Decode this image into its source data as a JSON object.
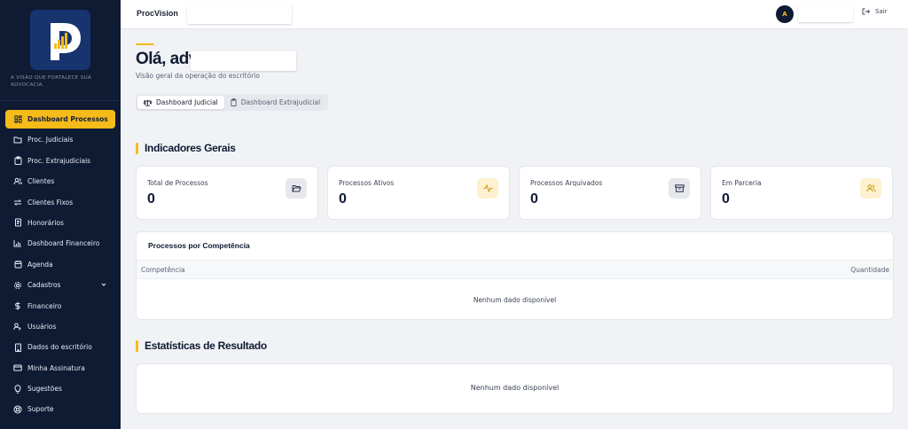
{
  "app": {
    "brand": "ProcVision",
    "tagline": "A visão que fortalece sua advocacia."
  },
  "sidebar": {
    "items": [
      {
        "label": "Dashboard Processos",
        "icon": "dashboard-grid-icon",
        "active": true
      },
      {
        "label": "Proc. Judiciais",
        "icon": "folder-icon"
      },
      {
        "label": "Proc. Extrajudiciais",
        "icon": "clipboard-icon"
      },
      {
        "label": "Clientes",
        "icon": "users-icon"
      },
      {
        "label": "Clientes Fixos",
        "icon": "repeat-icon"
      },
      {
        "label": "Honorários",
        "icon": "receipt-icon"
      },
      {
        "label": "Dashboard Financeiro",
        "icon": "bar-chart-icon"
      },
      {
        "label": "Agenda",
        "icon": "calendar-icon"
      },
      {
        "label": "Cadastros",
        "icon": "gear-icon",
        "has_submenu": true
      },
      {
        "label": "Financeiro",
        "icon": "dollar-icon"
      },
      {
        "label": "Usuários",
        "icon": "user-key-icon"
      },
      {
        "label": "Dados do escritório",
        "icon": "building-icon"
      },
      {
        "label": "Minha Assinatura",
        "icon": "credit-card-icon"
      },
      {
        "label": "Sugestões",
        "icon": "lightbulb-icon"
      },
      {
        "label": "Suporte",
        "icon": "lifebuoy-icon"
      }
    ]
  },
  "header": {
    "avatar_initial": "A",
    "logout_label": "Sair"
  },
  "main": {
    "greeting": "Olá, adv.",
    "subtitle": "Visão geral da operação do escritório",
    "tabs": [
      {
        "label": "Dashboard Judicial",
        "active": true
      },
      {
        "label": "Dashboard Extrajudicial",
        "active": false
      }
    ],
    "indicators": {
      "title": "Indicadores Gerais",
      "cards": [
        {
          "label": "Total de Processos",
          "value": "0",
          "icon": "folder-open-icon"
        },
        {
          "label": "Processos Ativos",
          "value": "0",
          "icon": "activity-icon"
        },
        {
          "label": "Processos Arquivados",
          "value": "0",
          "icon": "archive-icon"
        },
        {
          "label": "Em Parceria",
          "value": "0",
          "icon": "partners-icon"
        }
      ]
    },
    "competencia": {
      "title": "Processos por Competência",
      "columns": [
        "Competência",
        "Quantidade"
      ],
      "empty_text": "Nenhum dado disponível"
    },
    "estatisticas": {
      "title": "Estatísticas de Resultado",
      "empty_text": "Nenhum dado disponível"
    }
  },
  "colors": {
    "accent": "#f4bb19",
    "sidebar_bg": "#0f1a33",
    "logo_bg": "#17346f"
  }
}
